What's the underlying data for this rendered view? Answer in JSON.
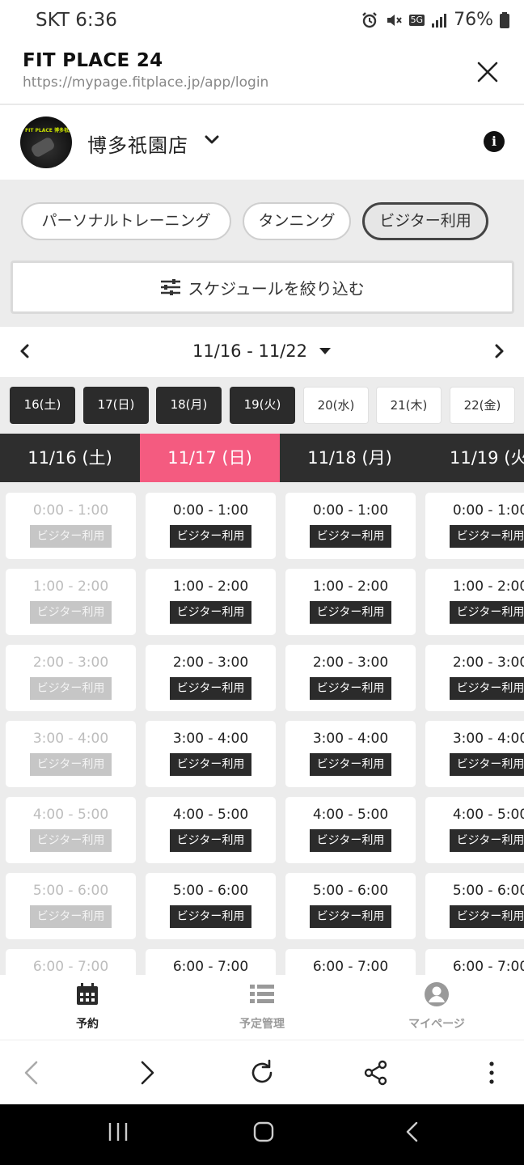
{
  "status_bar": {
    "time": "SKT 6:36",
    "network": "5G",
    "battery": "76%"
  },
  "browser": {
    "site_title": "FIT PLACE 24",
    "url": "https://mypage.fitplace.jp/app/login"
  },
  "store": {
    "logo_text": "FIT PLACE 博多祇園",
    "name": "博多祇園店"
  },
  "filters": {
    "chips": [
      {
        "label": "パーソナルトレーニング",
        "active": false
      },
      {
        "label": "タンニング",
        "active": false
      },
      {
        "label": "ビジター利用",
        "active": true
      }
    ],
    "schedule_filter_label": "スケジュールを絞り込む"
  },
  "week": {
    "range": "11/16 - 11/22"
  },
  "day_pills": [
    {
      "label": "16(土)",
      "available": true
    },
    {
      "label": "17(日)",
      "available": true
    },
    {
      "label": "18(月)",
      "available": true
    },
    {
      "label": "19(火)",
      "available": true
    },
    {
      "label": "20(水)",
      "available": false
    },
    {
      "label": "21(木)",
      "available": false
    },
    {
      "label": "22(金)",
      "available": false
    }
  ],
  "day_headers": [
    {
      "label": "11/16 (土)",
      "today": false
    },
    {
      "label": "11/17 (日)",
      "today": true
    },
    {
      "label": "11/18 (月)",
      "today": false
    },
    {
      "label": "11/19 (火",
      "today": false
    }
  ],
  "time_slots": [
    "0:00 - 1:00",
    "1:00 - 2:00",
    "2:00 - 3:00",
    "3:00 - 4:00",
    "4:00 - 5:00",
    "5:00 - 6:00",
    "6:00 - 7:00"
  ],
  "slot_tag": "ビジター利用",
  "past_column_index": 0,
  "bottom_tabs": [
    {
      "label": "予約",
      "icon": "calendar-icon",
      "active": true
    },
    {
      "label": "予定管理",
      "icon": "list-icon",
      "active": false
    },
    {
      "label": "マイページ",
      "icon": "user-icon",
      "active": false
    }
  ],
  "colors": {
    "accent": "#f45b80",
    "dark": "#2b2b2b",
    "background": "#ececec"
  }
}
